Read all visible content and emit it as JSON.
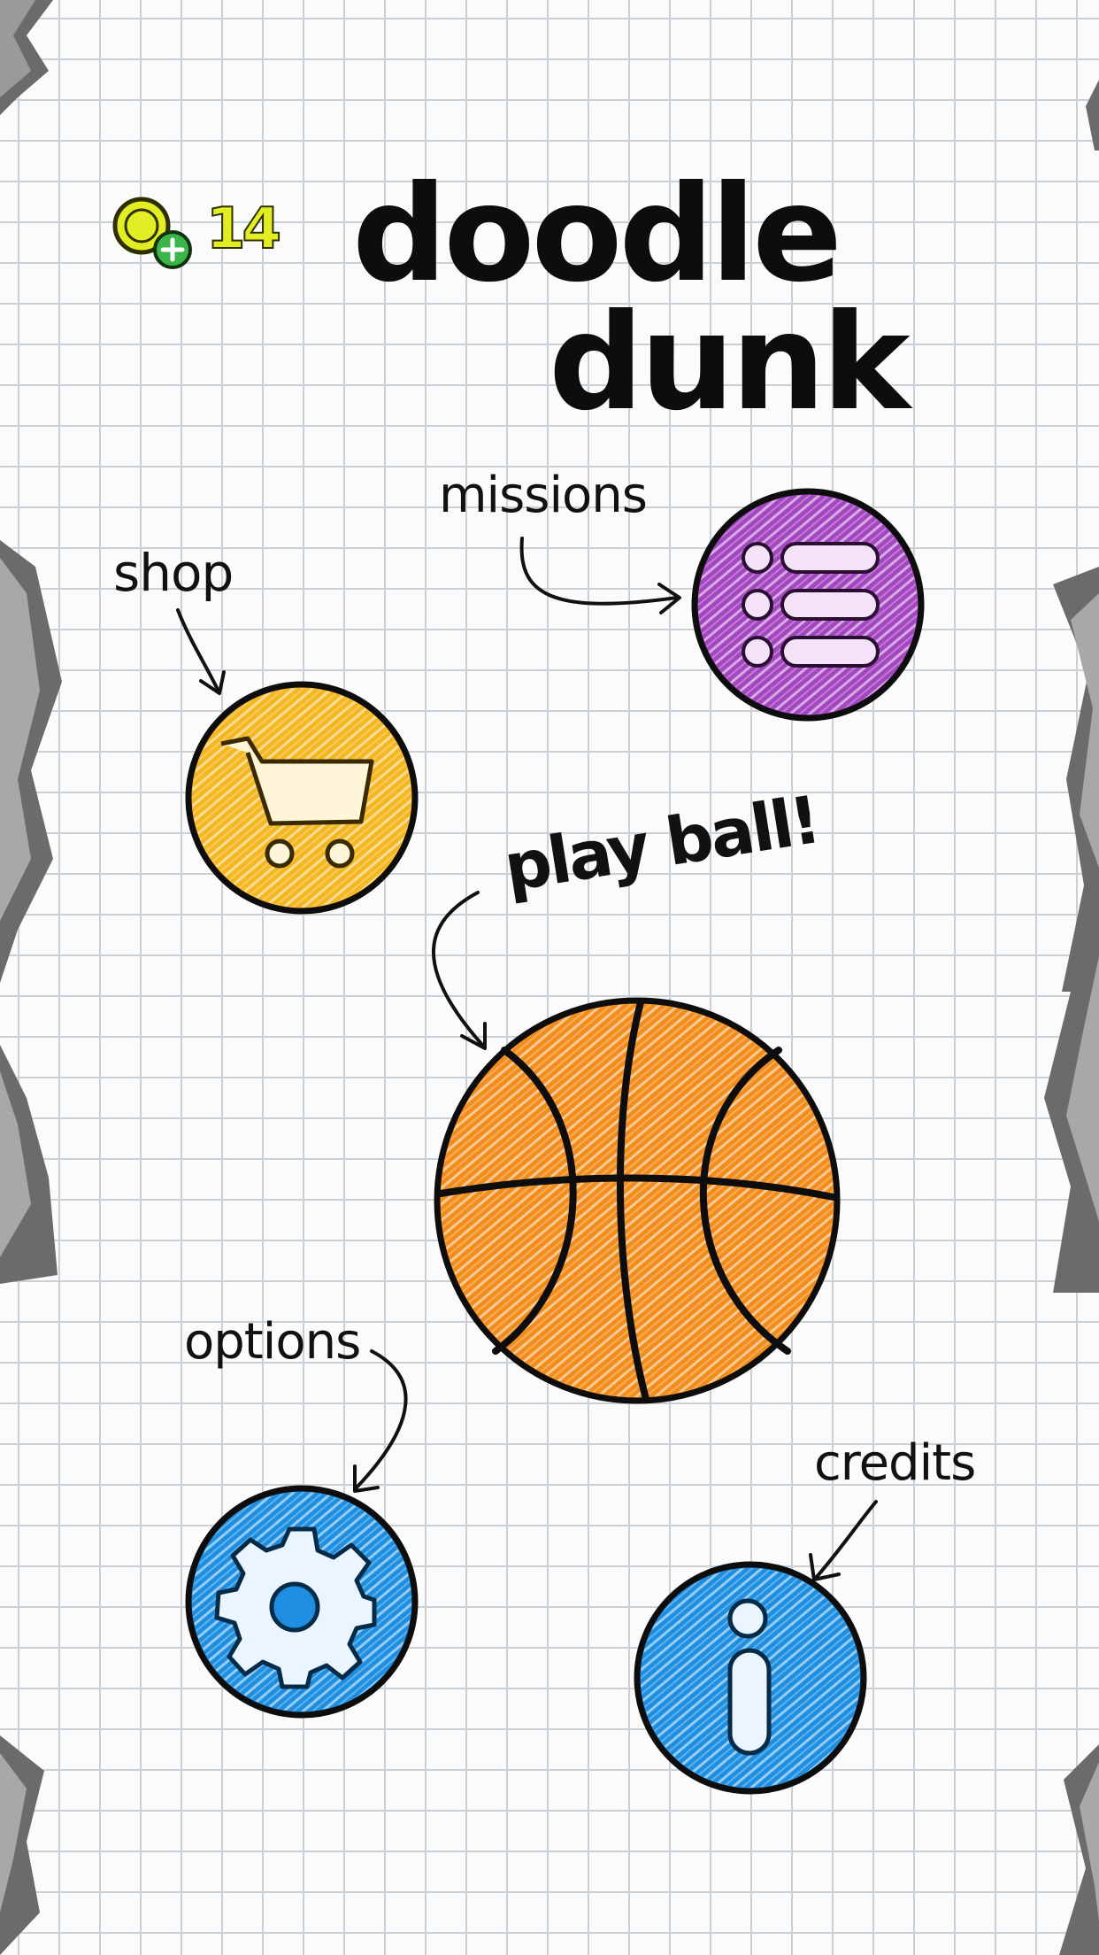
{
  "header": {
    "coins": "14",
    "title_line1": "doodle",
    "title_line2": "dunk"
  },
  "menu": {
    "shop_label": "shop",
    "missions_label": "missions",
    "play_label": "play ball!",
    "options_label": "options",
    "credits_label": "credits"
  },
  "icons": {
    "coin": "coin-icon",
    "add_coins": "plus-icon",
    "shop": "shopping-cart-icon",
    "missions": "list-icon",
    "play": "basketball-icon",
    "options": "gear-icon",
    "credits": "info-icon"
  },
  "colors": {
    "coin": "#e2ee23",
    "add_coins": "#3bb54a",
    "shop": "#f5b620",
    "missions": "#a346c0",
    "play": "#f28c1a",
    "options": "#1e8fe0",
    "credits": "#1e8fe0"
  }
}
